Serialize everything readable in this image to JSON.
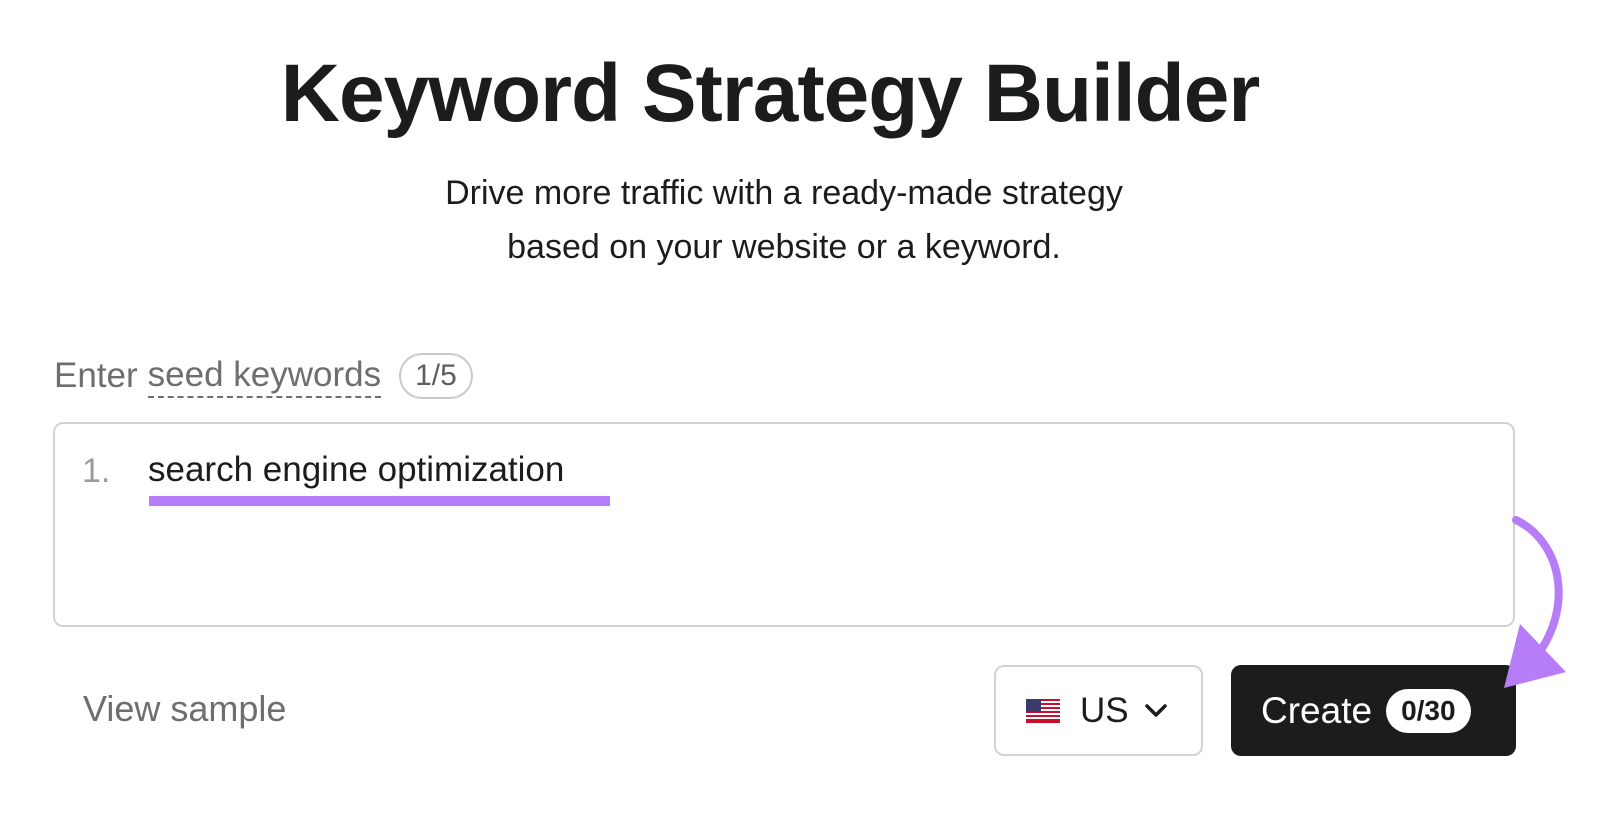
{
  "header": {
    "title": "Keyword Strategy Builder",
    "subtitle_line1": "Drive more traffic with a ready-made strategy",
    "subtitle_line2": "based on your website or a keyword."
  },
  "seed": {
    "label_prefix": "Enter",
    "label_term": "seed keywords",
    "count": "1/5"
  },
  "keywords": [
    {
      "number": "1.",
      "text": "search engine optimization"
    }
  ],
  "footer": {
    "view_sample_label": "View sample",
    "country": {
      "code": "US",
      "flag_icon": "us-flag-icon"
    },
    "create": {
      "label": "Create",
      "limit": "0/30"
    }
  },
  "colors": {
    "text_dark": "#1b1d1c",
    "text_muted": "#6c6e6f",
    "border": "#d2d3d5",
    "highlight_purple": "#b77cf8",
    "button_dark": "#1b1d1c"
  }
}
